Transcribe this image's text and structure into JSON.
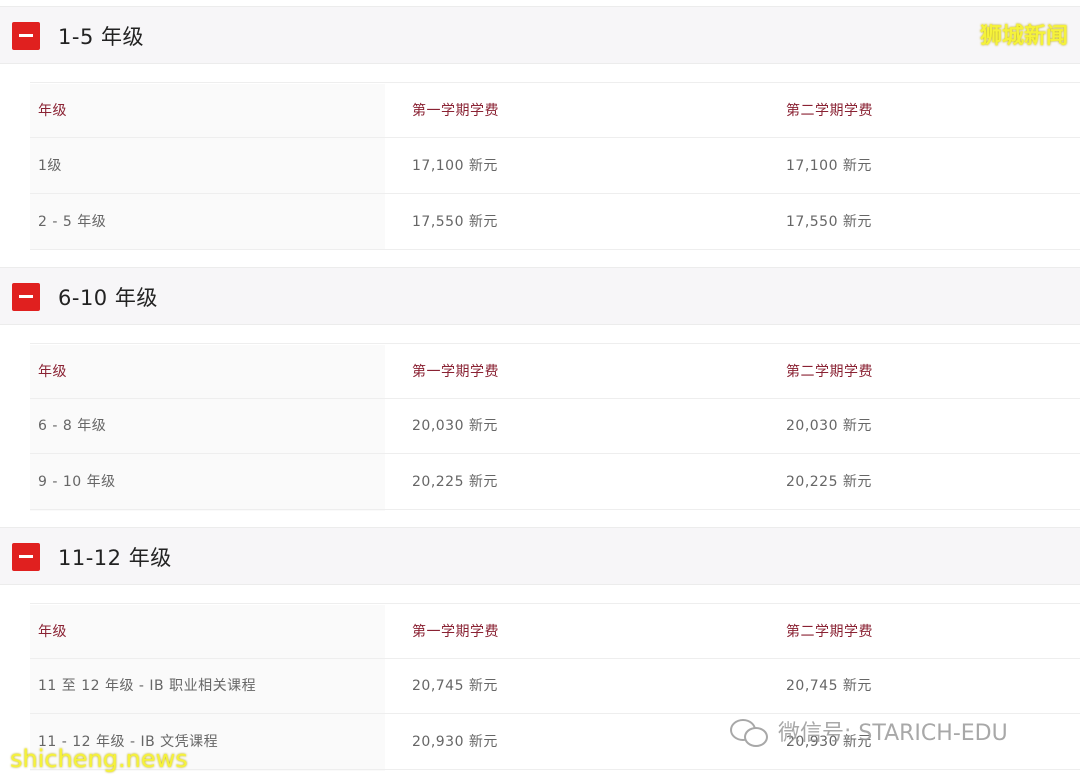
{
  "watermarks": {
    "top": "狮城新闻",
    "bottom": "shicheng.news",
    "wechat": "微信号: STARICH-EDU"
  },
  "sections": [
    {
      "title": "1-5 年级",
      "headers": [
        "年级",
        "第一学期学费",
        "第二学期学费"
      ],
      "rows": [
        [
          "1级",
          "17,100 新元",
          "17,100 新元"
        ],
        [
          "2 - 5 年级",
          "17,550 新元",
          "17,550 新元"
        ]
      ]
    },
    {
      "title": "6-10 年级",
      "headers": [
        "年级",
        "第一学期学费",
        "第二学期学费"
      ],
      "rows": [
        [
          "6 - 8 年级",
          "20,030 新元",
          "20,030 新元"
        ],
        [
          "9 - 10 年级",
          "20,225 新元",
          "20,225 新元"
        ]
      ]
    },
    {
      "title": "11-12 年级",
      "headers": [
        "年级",
        "第一学期学费",
        "第二学期学费"
      ],
      "rows": [
        [
          "11 至 12 年级 - IB 职业相关课程",
          "20,745 新元",
          "20,745 新元"
        ],
        [
          "11 - 12 年级 - IB 文凭课程",
          "20,930 新元",
          "20,930 新元"
        ]
      ]
    }
  ]
}
